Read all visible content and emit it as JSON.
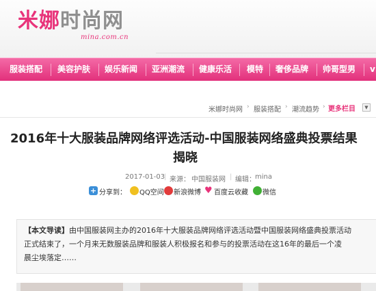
{
  "brand": {
    "logo_main_pink": "米娜",
    "logo_main_gray": "时尚网",
    "logo_url": "mina.com.cn"
  },
  "nav": {
    "items": [
      "服装搭配",
      "美容护肤",
      "娱乐新闻",
      "亚洲潮流",
      "健康乐活",
      "模特",
      "奢侈品牌",
      "帅哥型男"
    ],
    "overflow": "v"
  },
  "breadcrumb": {
    "items": [
      "米娜时尚网",
      "服装搭配",
      "潮流趋势"
    ],
    "more_label": "更多栏目"
  },
  "article": {
    "title_line1": "2016年十大服装品牌网络评选活动-中国服装网络盛典投票结果",
    "title_line2": "揭晓",
    "date": "2017-01-03",
    "source_label": "来源：",
    "source": "中国服装网",
    "editor_label": "编辑：",
    "editor": "mina"
  },
  "share": {
    "label": "分享到：",
    "targets": [
      "QQ空间",
      "新浪微博",
      "百度云收藏",
      "微信"
    ]
  },
  "summary": {
    "label": "【本文导读】",
    "line1": "由中国服装网主办的2016年十大服装品牌网络评选活动暨中国服装网络盛典投票活动",
    "line2": "正式结束了，一个月来无数服装品牌和服装人积极报名和参与的投票活动在这16年的最后一个凌",
    "line3": "晨尘埃落定……"
  },
  "colors": {
    "brand_pink": "#e8337a",
    "nav_top": "#f46aa6",
    "nav_bottom": "#e2307b"
  }
}
